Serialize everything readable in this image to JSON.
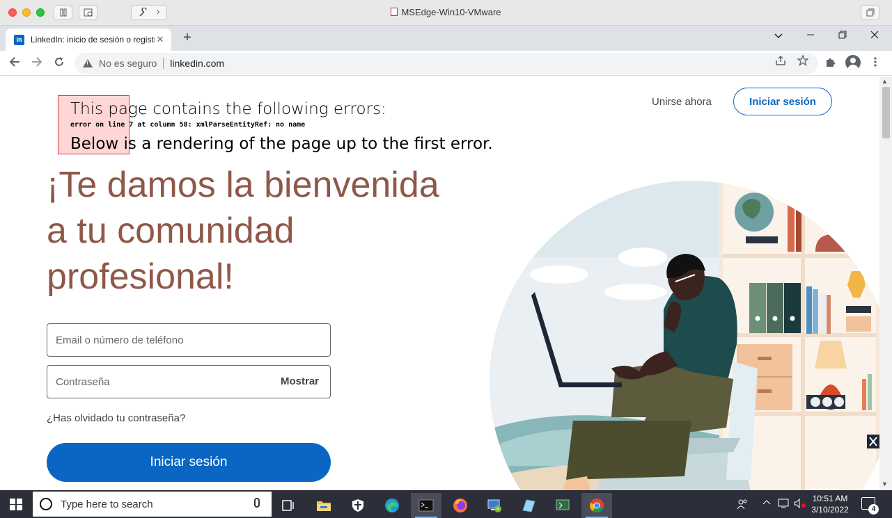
{
  "vm": {
    "title": "MSEdge-Win10-VMware"
  },
  "browser": {
    "tab_title": "LinkedIn: inicio de sesión o registro",
    "tab_close": "✕",
    "new_tab": "+",
    "security_label": "No es seguro",
    "url": "linkedin.com"
  },
  "error": {
    "heading": "This page contains the following errors:",
    "detail": "error on line 7 at column 58: xmlParseEntityRef: no name",
    "footer": "Below is a rendering of the page up to the first error."
  },
  "header": {
    "join_label": "Unirse ahora",
    "signin_label": "Iniciar sesión"
  },
  "hero": {
    "line1": "¡Te damos la bienvenida",
    "line2": "a tu comunidad",
    "line3": "profesional!"
  },
  "form": {
    "email_placeholder": "Email o número de teléfono",
    "password_placeholder": "Contraseña",
    "show_label": "Mostrar",
    "forgot_label": "¿Has olvidado tu contraseña?",
    "submit_label": "Iniciar sesión"
  },
  "taskbar": {
    "search_placeholder": "Type here to search",
    "time": "10:51 AM",
    "date": "3/10/2022",
    "notification_count": "4"
  },
  "colors": {
    "linkedin_blue": "#0a66c2",
    "hero_text": "#8f5849",
    "error_box": "#ffb4b4"
  },
  "icons": [
    "back-icon",
    "forward-icon",
    "reload-icon",
    "warning-icon",
    "share-icon",
    "star-icon",
    "extensions-icon",
    "profile-icon",
    "menu-icon",
    "windows-start-icon",
    "search-icon",
    "mic-icon",
    "task-view-icon",
    "file-explorer-icon",
    "security-icon",
    "edge-icon",
    "terminal-icon",
    "firefox-icon",
    "network-icon",
    "app-icon",
    "vmware-icon",
    "chrome-icon",
    "people-icon",
    "chevron-up-icon",
    "network-tray-icon",
    "volume-muted-icon",
    "notifications-icon"
  ]
}
